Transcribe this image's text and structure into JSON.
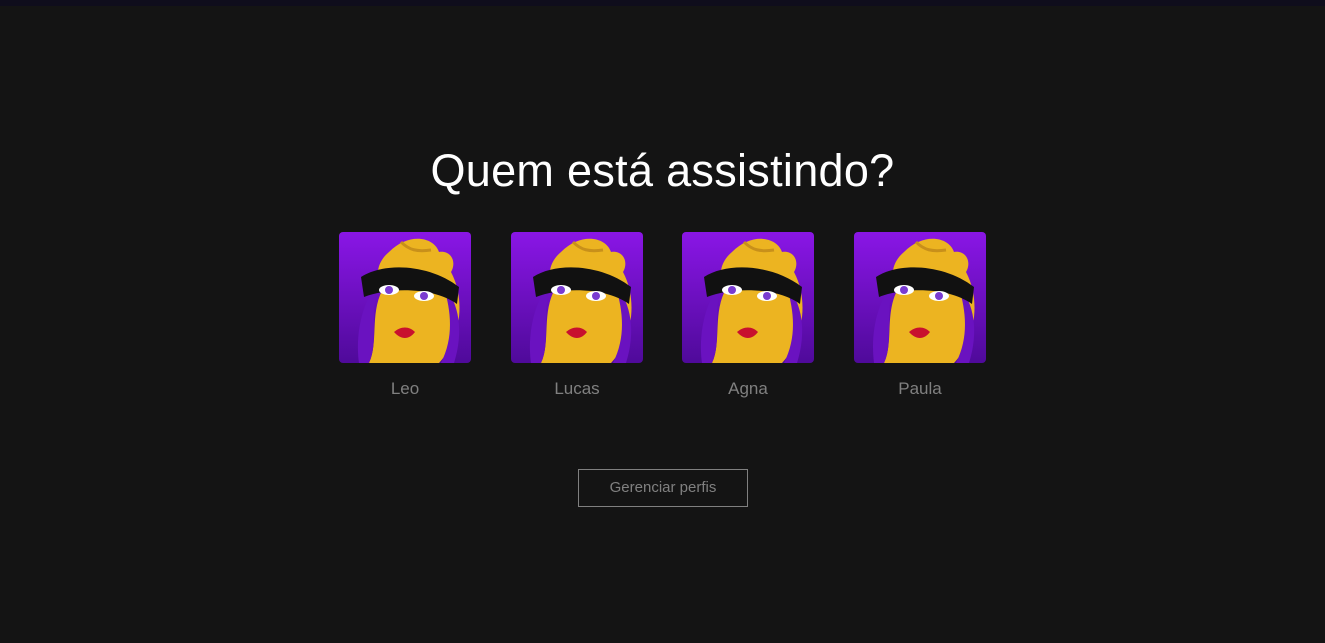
{
  "page": {
    "title": "Quem está assistindo?"
  },
  "profiles": [
    {
      "name": "Leo",
      "avatar_icon": "masked-woman-avatar"
    },
    {
      "name": "Lucas",
      "avatar_icon": "masked-woman-avatar"
    },
    {
      "name": "Agna",
      "avatar_icon": "masked-woman-avatar"
    },
    {
      "name": "Paula",
      "avatar_icon": "masked-woman-avatar"
    }
  ],
  "actions": {
    "manage_label": "Gerenciar perfis"
  },
  "colors": {
    "background": "#141414",
    "title": "#ffffff",
    "muted": "#808080",
    "avatar_purple": "#7a10d6",
    "avatar_yellow": "#ecb421",
    "mask": "#111111",
    "lips": "#c8102e"
  }
}
